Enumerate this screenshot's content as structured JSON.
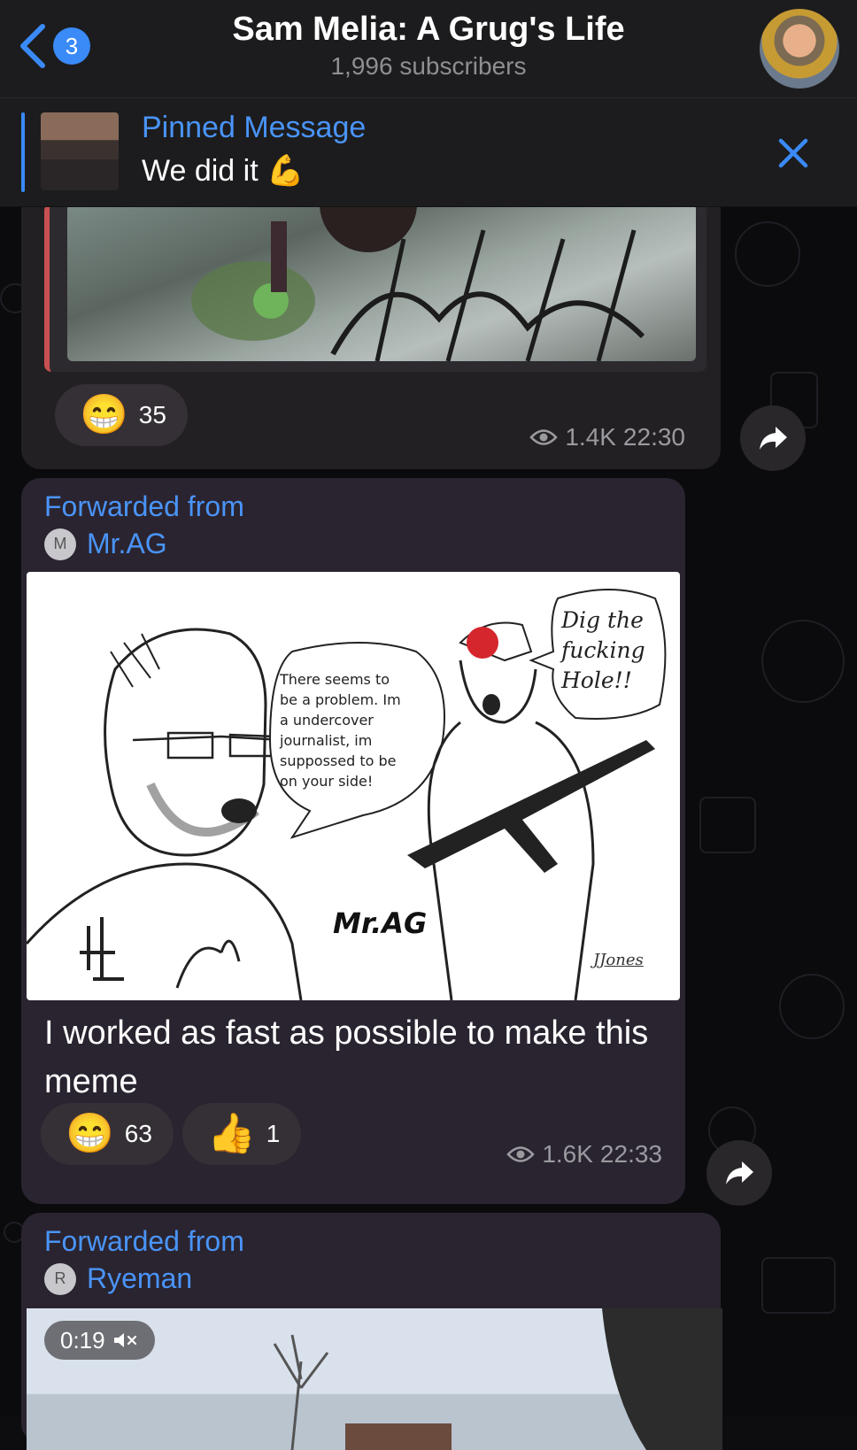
{
  "header": {
    "back_count": "3",
    "title": "Sam Melia: A Grug's Life",
    "subtitle": "1,996 subscribers"
  },
  "pinned": {
    "label": "Pinned Message",
    "text": "We did it 💪"
  },
  "messages": [
    {
      "reactions": [
        {
          "emoji": "😁",
          "count": "35"
        }
      ],
      "views": "1.4K",
      "time": "22:30"
    },
    {
      "forwarded_label": "Forwarded from",
      "forwarded_initial": "M",
      "forwarded_name": "Mr.AG",
      "meme": {
        "speech_left": [
          "There seems to",
          "be a problem. Im",
          "a undercover",
          "journalist, im",
          "suppossed to be",
          "on your side!"
        ],
        "speech_right": [
          "Dig the",
          "fucking",
          "Hole!!"
        ],
        "signature": "Mr.AG",
        "artist": "JJones",
        "logo": "4"
      },
      "caption": "I worked as fast as possible to make this meme",
      "reactions": [
        {
          "emoji": "😁",
          "count": "63"
        },
        {
          "emoji": "👍",
          "count": "1"
        }
      ],
      "views": "1.6K",
      "time": "22:33"
    },
    {
      "forwarded_label": "Forwarded from",
      "forwarded_initial": "R",
      "forwarded_name": "Ryeman",
      "duration": "0:19"
    }
  ],
  "colors": {
    "accent": "#4a94f8",
    "bubble": "#2a2430",
    "header": "#1c1c1e"
  }
}
